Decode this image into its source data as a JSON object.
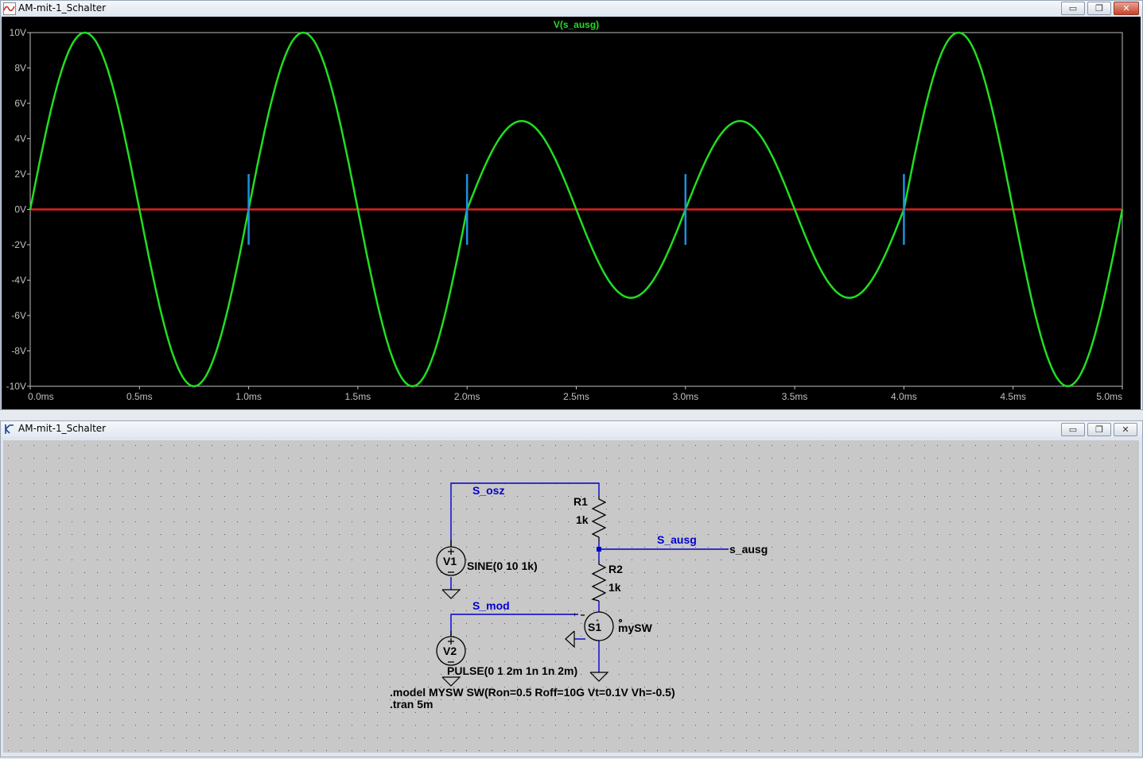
{
  "plot_window": {
    "title": "AM-mit-1_Schalter",
    "trace_label": "V(s_ausg)",
    "buttons": {
      "minimize": "▭",
      "restore": "❐",
      "close": "✕"
    }
  },
  "chart_data": {
    "type": "line",
    "title": "V(s_ausg)",
    "xlabel": "",
    "ylabel": "",
    "xlim": [
      0,
      5
    ],
    "ylim": [
      -10,
      10
    ],
    "x_unit": "ms",
    "y_unit": "V",
    "x_ticks": [
      "0.0ms",
      "0.5ms",
      "1.0ms",
      "1.5ms",
      "2.0ms",
      "2.5ms",
      "3.0ms",
      "3.5ms",
      "4.0ms",
      "4.5ms",
      "5.0ms"
    ],
    "y_ticks": [
      "10V",
      "8V",
      "6V",
      "4V",
      "2V",
      "0V",
      "-2V",
      "-4V",
      "-6V",
      "-8V",
      "-10V"
    ],
    "background": "#000000",
    "series": [
      {
        "name": "V(s_ausg)",
        "color": "#22dd22",
        "description_points": [
          {
            "x": 0.0,
            "y": 0
          },
          {
            "x": 0.25,
            "y": 10
          },
          {
            "x": 0.5,
            "y": 0
          },
          {
            "x": 0.75,
            "y": -10
          },
          {
            "x": 1.0,
            "y": 0
          },
          {
            "x": 1.25,
            "y": 10
          },
          {
            "x": 1.5,
            "y": 0
          },
          {
            "x": 1.75,
            "y": -10
          },
          {
            "x": 2.0,
            "y": 0
          },
          {
            "x": 2.25,
            "y": 5
          },
          {
            "x": 2.5,
            "y": 0
          },
          {
            "x": 2.75,
            "y": -5
          },
          {
            "x": 3.0,
            "y": 0
          },
          {
            "x": 3.25,
            "y": 5
          },
          {
            "x": 3.5,
            "y": 0
          },
          {
            "x": 3.75,
            "y": -5
          },
          {
            "x": 4.0,
            "y": 0
          },
          {
            "x": 4.25,
            "y": 10
          },
          {
            "x": 4.5,
            "y": 0
          },
          {
            "x": 4.75,
            "y": -10
          },
          {
            "x": 5.0,
            "y": 0
          }
        ]
      }
    ],
    "zero_line_color": "#e02020",
    "markers": {
      "color": "#1e90e0",
      "x": [
        1.0,
        2.0,
        3.0,
        4.0
      ],
      "y_range": [
        -2,
        2
      ]
    }
  },
  "schematic_window": {
    "title": "AM-mit-1_Schalter",
    "buttons": {
      "minimize": "▭",
      "restore": "❐",
      "close": "✕"
    },
    "net_labels": {
      "s_osz": "S_osz",
      "s_mod": "S_mod",
      "s_ausg": "S_ausg",
      "s_ausg_out": "s_ausg"
    },
    "components": {
      "r1_name": "R1",
      "r1_value": "1k",
      "r2_name": "R2",
      "r2_value": "1k",
      "v1_name": "V1",
      "v1_value": "SINE(0 10 1k)",
      "v2_name": "V2",
      "v2_value": "PULSE(0 1 2m 1n 1n 2m)",
      "s1_name": "S1",
      "s1_model": "mySW"
    },
    "directives": {
      "model": ".model MYSW SW(Ron=0.5 Roff=10G Vt=0.1V Vh=-0.5)",
      "tran": ".tran 5m"
    },
    "colors": {
      "wire": "#0000cc",
      "component": "#000000",
      "label": "#0000cc",
      "background": "#c8c8c8"
    }
  }
}
